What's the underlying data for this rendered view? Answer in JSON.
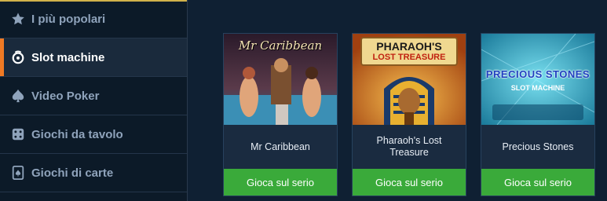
{
  "sidebar": {
    "items": [
      {
        "label": "I più popolari",
        "icon": "star-icon"
      },
      {
        "label": "Slot machine",
        "icon": "slot-icon",
        "active": true
      },
      {
        "label": "Video Poker",
        "icon": "spade-icon"
      },
      {
        "label": "Giochi da tavolo",
        "icon": "dice-icon"
      },
      {
        "label": "Giochi di carte",
        "icon": "card-icon"
      }
    ]
  },
  "games": [
    {
      "title": "Mr Caribbean",
      "thumb_logo": "Mr Caribbean",
      "button": "Gioca sul serio"
    },
    {
      "title": "Pharaoh's Lost Treasure",
      "thumb_logo_line1": "PHARAOH'S",
      "thumb_logo_line2": "LOST TREASURE",
      "button": "Gioca sul serio"
    },
    {
      "title": "Precious Stones",
      "thumb_logo_line1": "PRECIOUS STONES",
      "thumb_logo_line2": "SLOT MACHINE",
      "button": "Gioca sul serio"
    }
  ],
  "colors": {
    "accent": "#f07a24",
    "button": "#3aaa3a",
    "background": "#0f2033"
  }
}
